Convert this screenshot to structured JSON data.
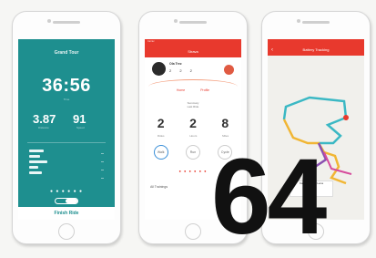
{
  "page_number": "64",
  "phone1": {
    "title": "Grand Tour",
    "time": "36:56",
    "time_label": "Time",
    "distance": "3.87",
    "speed": "91",
    "distance_label": "Distance",
    "speed_label": "Speed",
    "toggle_label": "01",
    "dots": "● ● ● ● ● ●",
    "finish_label": "Finish Ride"
  },
  "phone2": {
    "status": "Carrier",
    "header_title": "Strava",
    "name": "Ola Trez",
    "stats": "2 2 2",
    "tabs": [
      "Home",
      "Profile"
    ],
    "summary": [
      "Summary",
      "Last Ride"
    ],
    "big_numbers": [
      "2",
      "2",
      "8"
    ],
    "big_labels": [
      "Rides",
      "Hours",
      "Miles"
    ],
    "circles": [
      "Walk",
      "Run",
      "Cycle"
    ],
    "dots": "● ● ● ● ● ●",
    "footer": "All Trainings"
  },
  "phone3": {
    "header_title": "Battery Tracking",
    "back": "‹",
    "card_text": [
      "Kathe Hank & Lena",
      "Ride"
    ],
    "route_colors": [
      "#3bb8c4",
      "#f1b634",
      "#8a4fb0",
      "#d64b9c"
    ]
  },
  "colors": {
    "teal": "#1e8f8f",
    "red": "#e8392d"
  }
}
